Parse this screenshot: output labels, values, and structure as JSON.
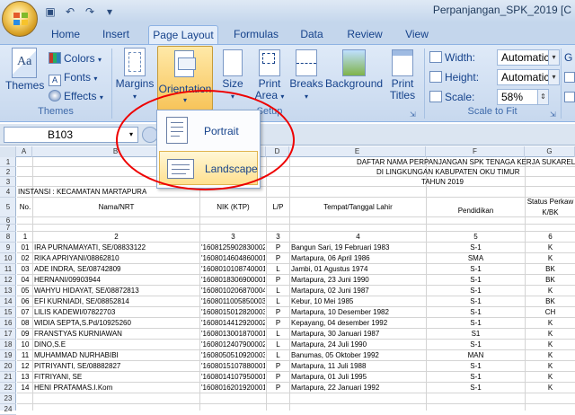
{
  "window": {
    "title": "Perpanjangan_SPK_2019  [C"
  },
  "tabs": [
    "Home",
    "Insert",
    "Page Layout",
    "Formulas",
    "Data",
    "Review",
    "View"
  ],
  "ribbon": {
    "themes_group": {
      "themes": "Themes",
      "colors": "Colors",
      "fonts": "Fonts",
      "effects": "Effects",
      "label": "Themes"
    },
    "page_setup": {
      "margins": "Margins",
      "orientation": "Orientation",
      "size": "Size",
      "print_area_1": "Print",
      "print_area_2": "Area",
      "breaks": "Breaks",
      "background": "Background",
      "print_titles_1": "Print",
      "print_titles_2": "Titles",
      "label": "Setup"
    },
    "scale_to_fit": {
      "width_label": "Width:",
      "width_value": "Automatic",
      "height_label": "Height:",
      "height_value": "Automatic",
      "scale_label": "Scale:",
      "scale_value": "58%",
      "label": "Scale to Fit"
    },
    "g_letter": "G"
  },
  "orientation_menu": {
    "portrait": "Portrait",
    "landscape": "Landscape"
  },
  "formula_bar": {
    "name_box": "B103"
  },
  "columns": [
    "A",
    "B",
    "C",
    "D",
    "E",
    "F",
    "G"
  ],
  "sheet": {
    "title1": "DAFTAR NAMA  PERPANJANGAN SPK TENAGA KERJA SUKARELA (TK",
    "title2": "DI LINGKUNGAN KABUPATEN OKU TIMUR",
    "title3": "TAHUN 2019",
    "instansi": "INSTANSI : KECAMATAN MARTAPURA",
    "headers": {
      "no": "No.",
      "nama": "Nama/NRT",
      "nik": "NIK (KTP)",
      "lp": "L/P",
      "ttl": "Tempat/Tanggal Lahir",
      "pendidikan": "Pendidikan",
      "status": "Status Perkaw",
      "status2": "K/BK"
    },
    "colnums": [
      "1",
      "2",
      "3",
      "3",
      "4",
      "5",
      "6"
    ],
    "rows": [
      {
        "n": "01",
        "nama": "IRA PURNAMAYATI, SE/08833122",
        "nik": "'1608125902830002",
        "lp": "P",
        "ttl": "Bangun Sari, 19 Februari 1983",
        "pend": "S-1",
        "st": "K"
      },
      {
        "n": "02",
        "nama": "RIKA APRIYANI/08862810",
        "nik": "'1608014604860001",
        "lp": "P",
        "ttl": "Martapura, 06 April 1986",
        "pend": "SMA",
        "st": "K"
      },
      {
        "n": "03",
        "nama": "ADE INDRA, SE/08742809",
        "nik": "'1608010108740001",
        "lp": "L",
        "ttl": "Jambi, 01 Agustus 1974",
        "pend": "S-1",
        "st": "BK"
      },
      {
        "n": "04",
        "nama": "HERNANI/09903944",
        "nik": "'1608018306900001",
        "lp": "P",
        "ttl": "Martapura, 23 Juni 1990",
        "pend": "S-1",
        "st": "BK"
      },
      {
        "n": "05",
        "nama": "WAHYU HIDAYAT, SE/08872813",
        "nik": "'1608010206870004",
        "lp": "L",
        "ttl": "Martapura, 02 Juni 1987",
        "pend": "S-1",
        "st": "K"
      },
      {
        "n": "06",
        "nama": "EFI KURNIADI, SE/08852814",
        "nik": "'1608011005850003",
        "lp": "L",
        "ttl": "Kebur, 10 Mei 1985",
        "pend": "S-1",
        "st": "BK"
      },
      {
        "n": "07",
        "nama": "LILIS KADEWI/07822703",
        "nik": "'1608015012820003",
        "lp": "P",
        "ttl": "Martapura, 10 Desember 1982",
        "pend": "S-1",
        "st": "CH"
      },
      {
        "n": "08",
        "nama": "WIDIA SEPTA,S.Pd/10925260",
        "nik": "'1608014412920002",
        "lp": "P",
        "ttl": "Kepayang, 04 desember 1992",
        "pend": "S-1",
        "st": "K"
      },
      {
        "n": "09",
        "nama": "FRANSTYAS KURNIAWAN",
        "nik": "'1608013001870001",
        "lp": "L",
        "ttl": "Martapura, 30 Januari 1987",
        "pend": "S1",
        "st": "K"
      },
      {
        "n": "10",
        "nama": "DINO,S.E",
        "nik": "'1608012407900002",
        "lp": "L",
        "ttl": "Martapura, 24 Juli 1990",
        "pend": "S-1",
        "st": "K"
      },
      {
        "n": "11",
        "nama": "MUHAMMAD NURHABIBI",
        "nik": "'1608050510920003",
        "lp": "L",
        "ttl": "Banumas, 05 Oktober 1992",
        "pend": "MAN",
        "st": "K"
      },
      {
        "n": "12",
        "nama": "PITRIYANTI, SE/08882827",
        "nik": "'1608015107880001",
        "lp": "P",
        "ttl": "Martapura, 11 Juli 1988",
        "pend": "S-1",
        "st": "K"
      },
      {
        "n": "13",
        "nama": "FITRIYANI, SE",
        "nik": "'1608014107950001",
        "lp": "P",
        "ttl": "Martapura, 01 Juli 1995",
        "pend": "S-1",
        "st": "K"
      },
      {
        "n": "14",
        "nama": "HENI PRATAMAS.I.Kom",
        "nik": "'1608016201920001",
        "lp": "P",
        "ttl": "Martapura, 22 Januari 1992",
        "pend": "S-1",
        "st": "K"
      }
    ]
  }
}
